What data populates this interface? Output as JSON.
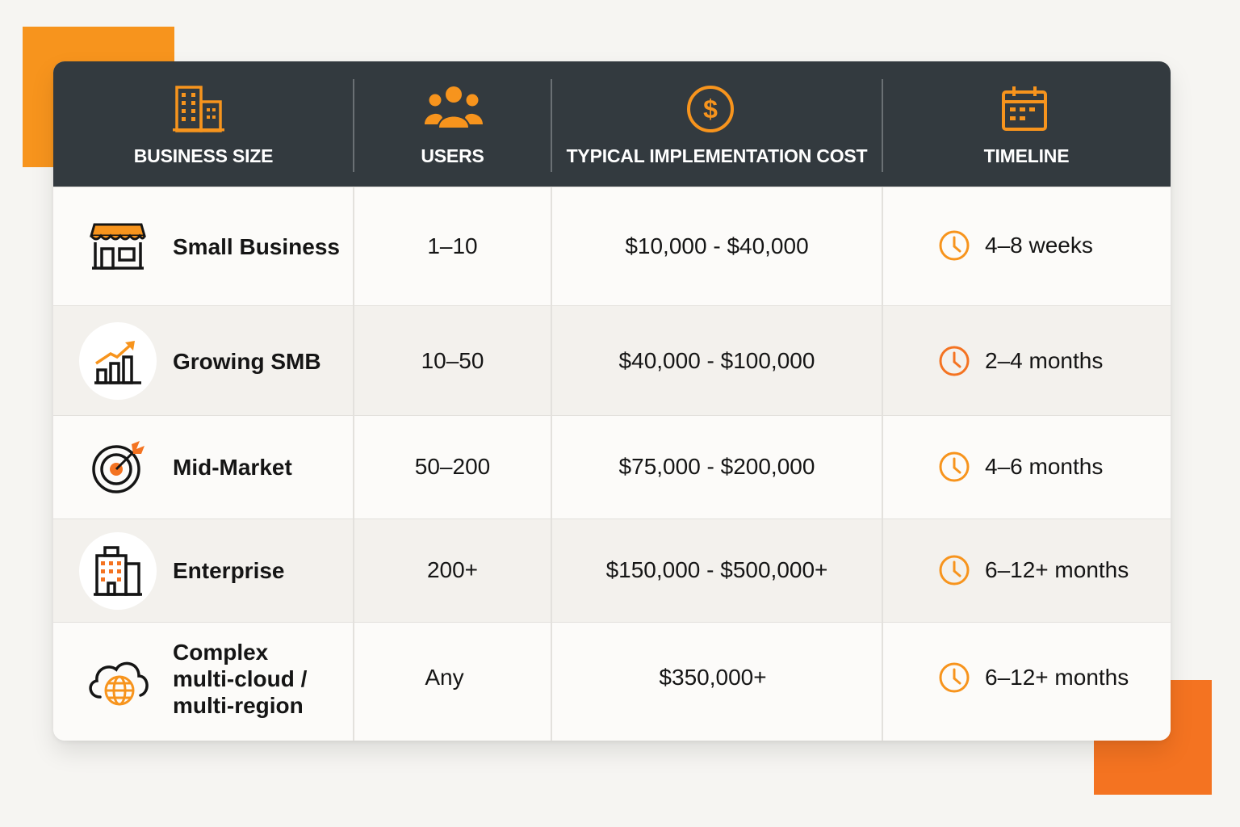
{
  "headers": {
    "business_size": "BUSINESS SIZE",
    "users": "USERS",
    "cost": "TYPICAL IMPLEMENTATION COST",
    "timeline": "TIMELINE"
  },
  "rows": [
    {
      "name": "Small Business",
      "users": "1–10",
      "cost": "$10,000 - $40,000",
      "timeline": "4–8 weeks",
      "icon": "storefront-icon"
    },
    {
      "name": "Growing SMB",
      "users": "10–50",
      "cost": "$40,000 - $100,000",
      "timeline": "2–4 months",
      "icon": "growth-chart-icon"
    },
    {
      "name": "Mid-Market",
      "users": "50–200",
      "cost": "$75,000 - $200,000",
      "timeline": "4–6 months",
      "icon": "target-icon"
    },
    {
      "name": "Enterprise",
      "users": "200+",
      "cost": "$150,000 - $500,000+",
      "timeline": "6–12+ months",
      "icon": "office-building-icon"
    },
    {
      "name_lines": [
        "Complex",
        "multi-cloud /",
        "multi-region"
      ],
      "users": "Any",
      "cost": "$350,000+",
      "timeline": "6–12+ months",
      "icon": "cloud-globe-icon"
    }
  ],
  "colors": {
    "accent_orange": "#f7941d",
    "header_bg": "#333a3f",
    "deco_orange": "#f47321"
  }
}
